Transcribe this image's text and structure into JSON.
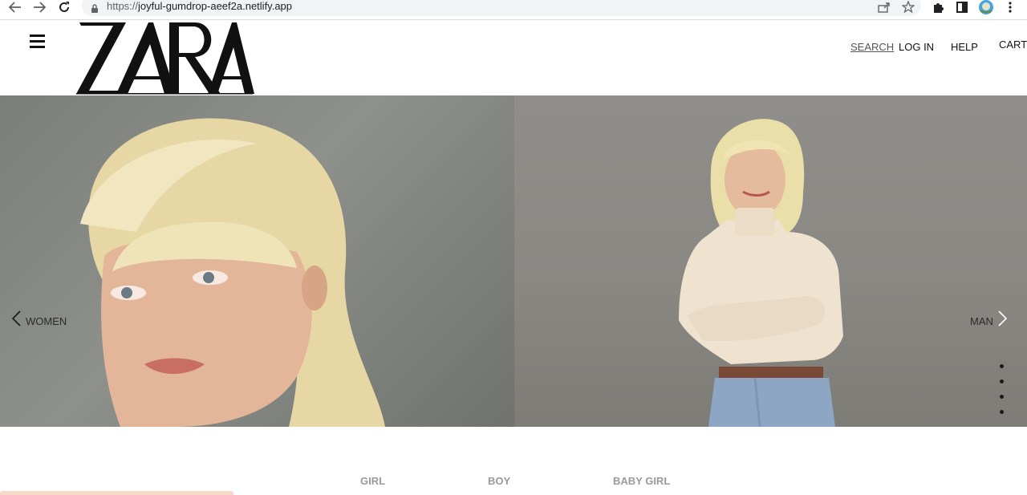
{
  "browser": {
    "url_scheme": "https://",
    "url_host": "joyful-gumdrop-aeef2a.netlify.app",
    "back_icon": "arrow-left-icon",
    "forward_icon": "arrow-right-icon",
    "reload_icon": "reload-icon",
    "lock_icon": "lock-icon",
    "share_icon": "share-icon",
    "bookmark_icon": "star-icon",
    "extensions_icon": "puzzle-icon",
    "sidepanel_icon": "side-panel-icon",
    "profile_icon": "avatar-icon",
    "menu_icon": "kebab-menu-icon"
  },
  "header": {
    "logo_text": "ZARA",
    "menu_icon": "hamburger-icon",
    "nav": {
      "search": "SEARCH",
      "login": "LOG IN",
      "help": "HELP",
      "cart": "CART"
    }
  },
  "hero": {
    "prev_label": "WOMEN",
    "next_label": "MAN",
    "prev_icon": "chevron-left-icon",
    "next_icon": "chevron-right-icon",
    "slide_count": 4
  },
  "categories": {
    "tabs": [
      "GIRL",
      "BOY",
      "BABY GIRL"
    ]
  },
  "colors": {
    "accent_peach": "#f7d9c9",
    "text_dark": "#111111",
    "tab_gray": "#9a9a9a"
  }
}
